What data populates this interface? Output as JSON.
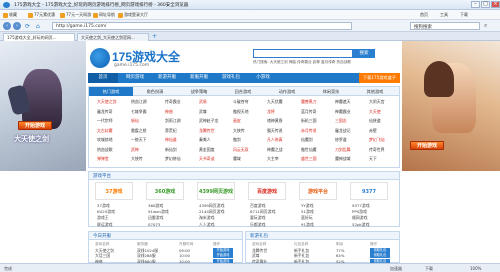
{
  "window": {
    "title": "175游戏大全 - 175游戏大全_好玩的网页游戏排行榜_网页游戏排行榜 - 360安全浏览器",
    "btn_min": "–",
    "btn_max": "□",
    "btn_close": "×"
  },
  "favorites": {
    "label": "收藏",
    "items": [
      "77元素优惠",
      "77元一天网游",
      "网址导航",
      "游戏登录大厅"
    ],
    "right": [
      "首页",
      "工具",
      "下载"
    ]
  },
  "address": {
    "back": "‹",
    "forward": "›",
    "url": "http://game.i175.com/",
    "engine": "搜狗搜索"
  },
  "tabs": [
    {
      "label": "175游戏大全_好玩的网页..."
    },
    {
      "label": "大天使之剑_大天使之剑官网..."
    }
  ],
  "ads": {
    "left_button": "开始游戏",
    "left_caption": "大天使之剑",
    "right_button": "开始游戏"
  },
  "header": {
    "logo_text": "175游戏大全",
    "logo_sub": "game.i175.com",
    "search_btn": "搜索",
    "hot_words": "热门搜索: 大天使之剑  神曲  传奇霸业  武尊  蓝月传奇  热血战歌"
  },
  "nav": {
    "items": [
      "首页",
      "网页游戏",
      "新游开服",
      "新服开服",
      "游戏礼包",
      "小游戏"
    ],
    "right": "下载175游戏盒子"
  },
  "categories": {
    "headers": [
      "热门游戏",
      "角色扮演",
      "战争策略",
      "回合游戏",
      "动作游戏",
      "休闲竞技",
      "其他游戏"
    ],
    "rows": [
      [
        "大天使之剑",
        "热血江湖",
        "传奇霸业",
        "武易",
        "斗破苍穹",
        "九天伏魔",
        "魔兽黑刀",
        "神魔遮天",
        "大闹天宫"
      ],
      [
        "屠龙传奇",
        "七雄争霸",
        "神曲",
        "武尊",
        "傲视天地",
        "龙将",
        "蓝月传奇",
        "神魔霸业",
        "大天使"
      ],
      [
        "一代宗师",
        "斩仙",
        "剑雨江湖",
        "武神赵子龙",
        "画皮",
        "诸神黄昏",
        "街机三国",
        "三国志",
        "仙侠道"
      ],
      [
        "太古封魔",
        "雷霆之怒",
        "莽荒纪",
        "龙腾传世",
        "大侠传",
        "霸天传说",
        "赤月传说",
        "屠龙战记",
        "赤壁"
      ],
      [
        "攻城掠地",
        "一统天下",
        "神仙道",
        "秦美人",
        "傲剑",
        "凡人修真",
        "仙魔剑",
        "修罗道",
        "梦幻飞仙"
      ],
      [
        "热血战歌",
        "武神",
        "新仙剑",
        "黄金国度",
        "风云无双",
        "神魔之战",
        "傲世仙魔",
        "刀剑乱舞",
        "传奇世界"
      ],
      [
        "弹弹堂",
        "大侠传",
        "梦幻修仙",
        "天书奇谈",
        "魔域",
        "大主宰",
        "盛世三国",
        "魔神战域",
        "天下"
      ]
    ]
  },
  "featured": {
    "title": "游戏平台",
    "logos": [
      {
        "label": "37游戏",
        "color": "#ff7a00"
      },
      {
        "label": "360游戏",
        "color": "#3a9b2a"
      },
      {
        "label": "4399网页游戏",
        "color": "#3a9b2a"
      },
      {
        "label": "百度游戏",
        "color": "#d8261b"
      },
      {
        "label": "游戏平台",
        "color": "#e85c0d"
      },
      {
        "label": "9377",
        "color": "#2b7fd0"
      }
    ],
    "links": [
      [
        "37游戏",
        "360游戏",
        "4399网页游戏",
        "百度游戏",
        "YY游戏",
        "9377游戏"
      ],
      [
        "KU25游戏",
        "91wan游戏",
        "2144网页游戏",
        "6711网页游戏",
        "51游戏",
        "PPS游戏"
      ],
      [
        "游戏王",
        "迅雷游戏",
        "淘米游戏",
        "要玩游戏",
        "蛮好玩",
        "顺网游戏"
      ],
      [
        "联运游戏",
        "07073",
        "人人游戏",
        "乐都游戏",
        "91游戏",
        "52pk游戏"
      ]
    ]
  },
  "panels": [
    {
      "title": "今日开服",
      "cols": [
        "游戏名称",
        "服务器",
        "开服时间",
        "操作"
      ],
      "rows": [
        [
          "大天使之剑",
          "双线1024服",
          "09:00",
          "开始游戏"
        ],
        [
          "大话三国",
          "双线288服",
          "10:00",
          "开始游戏"
        ],
        [
          "神曲",
          "双线880服",
          "10:00",
          "开始游戏"
        ]
      ]
    },
    {
      "title": "新游礼包",
      "cols": [
        "游戏名称",
        "礼包名称",
        "剩余",
        "操作"
      ],
      "rows": [
        [
          "龙腾传世",
          "新手礼包",
          "77%",
          "领取礼包"
        ],
        [
          "武尊",
          "新手礼包",
          "64%",
          "领取礼包"
        ],
        [
          "传奇霸业",
          "新手礼包",
          "52%",
          "领取礼包"
        ]
      ]
    }
  ],
  "status": {
    "left": "完成",
    "items": [
      "加速器",
      "下载",
      "100%"
    ]
  }
}
